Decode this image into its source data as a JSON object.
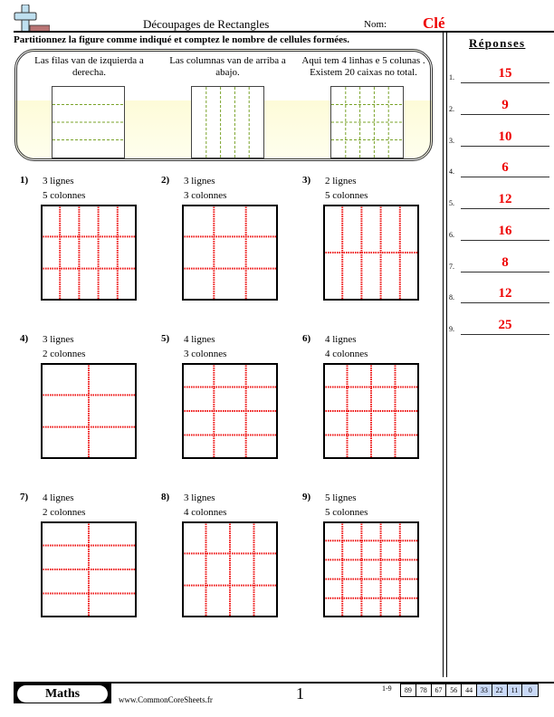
{
  "header": {
    "title": "Découpages de Rectangles",
    "name_label": "Nom:",
    "name_value": "Clé",
    "logo_icon": "plus-minus-logo-icon"
  },
  "instruction": "Partitionnez la figure comme indiqué et comptez le nombre de cellules formées.",
  "examples": [
    {
      "caption": "Las filas van de izquierda a derecha.",
      "rows": 4,
      "cols": 1
    },
    {
      "caption": "Las columnas van de arriba a abajo.",
      "rows": 1,
      "cols": 5
    },
    {
      "caption": "Aqui tem 4 linhas e 5 colunas . Existem 20 caixas no total.",
      "rows": 4,
      "cols": 5
    }
  ],
  "colors": {
    "example_line": "#7aa32a",
    "problem_line": "#ee1111",
    "answer": "#ee0000",
    "score_low_bg": "#c9d9f7"
  },
  "problems": [
    {
      "number": "1)",
      "rows_label": "3 lignes",
      "cols_label": "5 colonnes",
      "rows": 3,
      "cols": 5
    },
    {
      "number": "2)",
      "rows_label": "3 lignes",
      "cols_label": "3 colonnes",
      "rows": 3,
      "cols": 3
    },
    {
      "number": "3)",
      "rows_label": "2 lignes",
      "cols_label": "5 colonnes",
      "rows": 2,
      "cols": 5
    },
    {
      "number": "4)",
      "rows_label": "3 lignes",
      "cols_label": "2 colonnes",
      "rows": 3,
      "cols": 2
    },
    {
      "number": "5)",
      "rows_label": "4 lignes",
      "cols_label": "3 colonnes",
      "rows": 4,
      "cols": 3
    },
    {
      "number": "6)",
      "rows_label": "4 lignes",
      "cols_label": "4 colonnes",
      "rows": 4,
      "cols": 4
    },
    {
      "number": "7)",
      "rows_label": "4 lignes",
      "cols_label": "2 colonnes",
      "rows": 4,
      "cols": 2
    },
    {
      "number": "8)",
      "rows_label": "3 lignes",
      "cols_label": "4 colonnes",
      "rows": 3,
      "cols": 4
    },
    {
      "number": "9)",
      "rows_label": "5 lignes",
      "cols_label": "5 colonnes",
      "rows": 5,
      "cols": 5
    }
  ],
  "answers": {
    "title": "Réponses",
    "items": [
      {
        "label": "1.",
        "value": "15"
      },
      {
        "label": "2.",
        "value": "9"
      },
      {
        "label": "3.",
        "value": "10"
      },
      {
        "label": "4.",
        "value": "6"
      },
      {
        "label": "5.",
        "value": "12"
      },
      {
        "label": "6.",
        "value": "16"
      },
      {
        "label": "7.",
        "value": "8"
      },
      {
        "label": "8.",
        "value": "12"
      },
      {
        "label": "9.",
        "value": "25"
      }
    ]
  },
  "footer": {
    "subject": "Maths",
    "website": "www.CommonCoreSheets.fr",
    "page": "1",
    "score_range": "1-9",
    "scores": [
      "89",
      "78",
      "67",
      "56",
      "44",
      "33",
      "22",
      "11",
      "0"
    ],
    "low_score_start_index": 5
  }
}
